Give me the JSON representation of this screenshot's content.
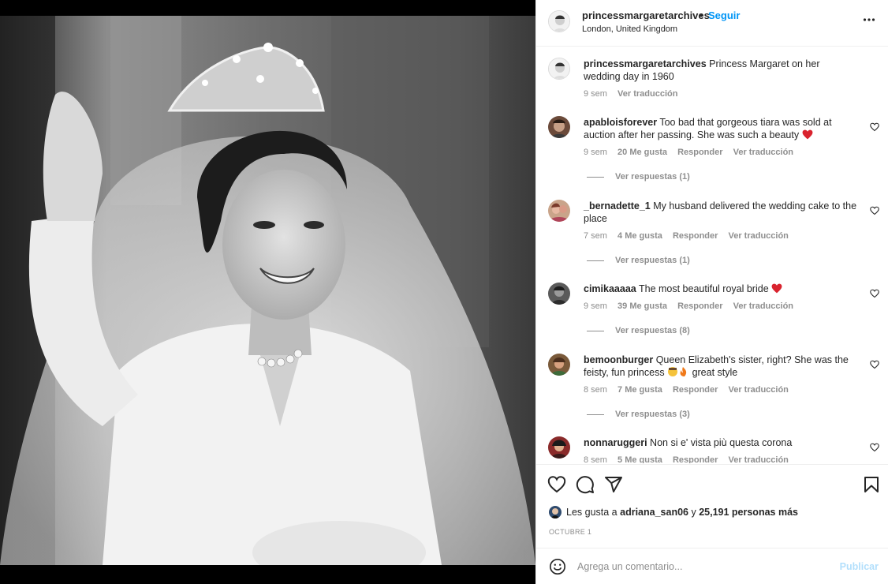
{
  "post": {
    "username": "princessmargaretarchives",
    "separator": "•",
    "follow_label": "Seguir",
    "location": "London, United Kingdom",
    "more_icon": "more-horizontal-icon"
  },
  "caption": {
    "username": "princessmargaretarchives",
    "text": "Princess Margaret on her wedding day in 1960",
    "time": "9 sem",
    "translate": "Ver traducción"
  },
  "comments": [
    {
      "username": "apabloisforever",
      "text": "Too bad that gorgeous tiara was sold at auction after her passing. She was such a beauty",
      "emoji": "red-heart",
      "time": "9 sem",
      "likes": "20 Me gusta",
      "reply": "Responder",
      "translate": "Ver traducción",
      "replies": "Ver respuestas (1)"
    },
    {
      "username": "_bernadette_1",
      "text": "My husband delivered the wedding cake to the place",
      "emoji": "",
      "time": "7 sem",
      "likes": "4 Me gusta",
      "reply": "Responder",
      "translate": "Ver traducción",
      "replies": "Ver respuestas (1)"
    },
    {
      "username": "cimikaaaaa",
      "text": "The most beautiful royal bride",
      "emoji": "red-heart",
      "time": "9 sem",
      "likes": "39 Me gusta",
      "reply": "Responder",
      "translate": "Ver traducción",
      "replies": "Ver respuestas (8)"
    },
    {
      "username": "bemoonburger",
      "text": "Queen Elizabeth's sister, right? She was the feisty, fun princess",
      "text_after": "great style",
      "emoji": "fire",
      "time": "8 sem",
      "likes": "7 Me gusta",
      "reply": "Responder",
      "translate": "Ver traducción",
      "replies": "Ver respuestas (3)"
    },
    {
      "username": "nonnaruggeri",
      "text": "Non si e' vista più questa corona",
      "emoji": "",
      "time": "8 sem",
      "likes": "5 Me gusta",
      "reply": "Responder",
      "translate": "Ver traducción",
      "replies": ""
    }
  ],
  "actions": {
    "like_icon": "heart-outline-icon",
    "comment_icon": "comment-icon",
    "share_icon": "send-icon",
    "save_icon": "bookmark-icon"
  },
  "likes": {
    "prefix": "Les gusta a",
    "user": "adriana_san06",
    "conj": "y",
    "others": "25,191 personas más"
  },
  "date": "OCTUBRE 1",
  "comment_box": {
    "placeholder": "Agrega un comentario...",
    "publish_label": "Publicar"
  },
  "colors": {
    "link_blue": "#0095f6",
    "publish_disabled": "#b2dffc",
    "secondary_text": "#8e8e8e",
    "heart_red": "#ed4956"
  }
}
